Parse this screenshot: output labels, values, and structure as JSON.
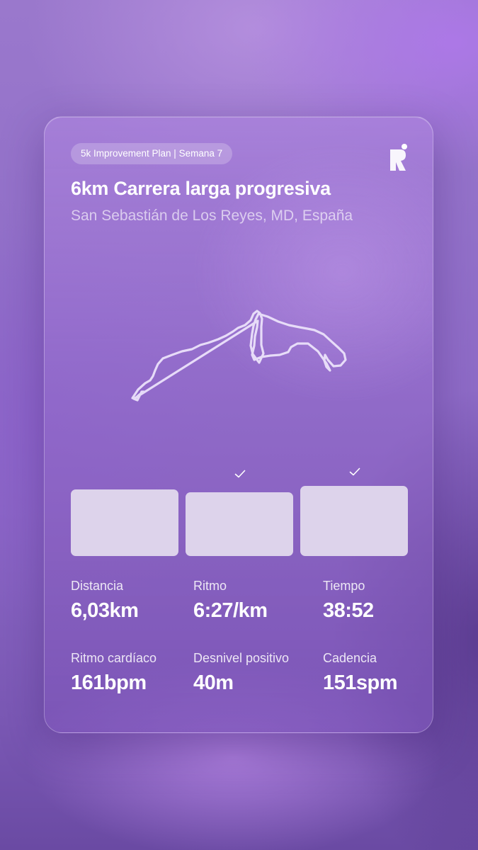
{
  "card": {
    "plan_badge": "5k Improvement Plan | Semana 7",
    "title": "6km Carrera larga progresiva",
    "location": "San Sebastián de Los Reyes, MD, España",
    "logo_icon": "runna-logo-icon",
    "route_icon": "route-map-trace"
  },
  "splits": [
    {
      "completed": false,
      "level": 0.95
    },
    {
      "completed": true,
      "level": 0.91
    },
    {
      "completed": true,
      "level": 1.0
    }
  ],
  "stats": [
    {
      "label": "Distancia",
      "value": "6,03km"
    },
    {
      "label": "Ritmo",
      "value": "6:27/km"
    },
    {
      "label": "Tiempo",
      "value": "38:52"
    },
    {
      "label": "Ritmo cardíaco",
      "value": "161bpm"
    },
    {
      "label": "Desnivel positivo",
      "value": "40m"
    },
    {
      "label": "Cadencia",
      "value": "151spm"
    }
  ],
  "colors": {
    "background": "#8a66c4",
    "card": "#9a74cf",
    "split_bar": "#ddd3eb",
    "text": "#ffffff"
  }
}
